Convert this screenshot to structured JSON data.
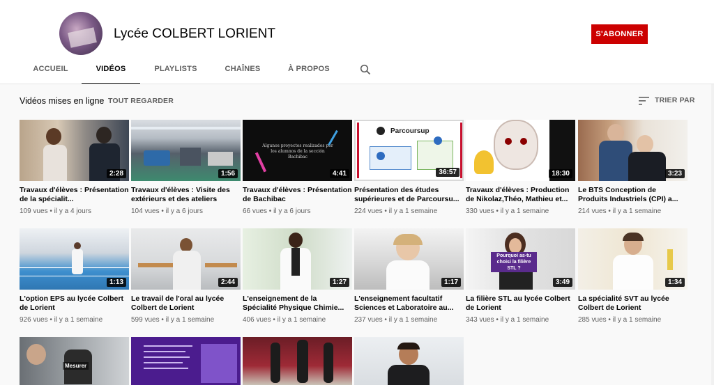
{
  "channel": {
    "title": "Lycée COLBERT LORIENT",
    "subscribe_label": "S'ABONNER"
  },
  "tabs": [
    {
      "label": "ACCUEIL",
      "active": false
    },
    {
      "label": "VIDÉOS",
      "active": true
    },
    {
      "label": "PLAYLISTS",
      "active": false
    },
    {
      "label": "CHAÎNES",
      "active": false
    },
    {
      "label": "À PROPOS",
      "active": false
    }
  ],
  "section": {
    "title": "Vidéos mises en ligne",
    "see_all": "TOUT REGARDER",
    "sort_label": "TRIER PAR"
  },
  "videos": [
    {
      "title": "Travaux d'élèves : Présentation de la spécialit...",
      "duration": "2:28",
      "views": "109 vues",
      "age": "il y a 4 jours"
    },
    {
      "title": "Travaux d'élèves : Visite des extérieurs et des ateliers",
      "duration": "1:56",
      "views": "104 vues",
      "age": "il y a 6 jours"
    },
    {
      "title": "Travaux d'élèves : Présentation de Bachibac",
      "duration": "4:41",
      "views": "66 vues",
      "age": "il y a 6 jours"
    },
    {
      "title": "Présentation des études supérieures et de Parcoursu...",
      "duration": "36:57",
      "views": "224 vues",
      "age": "il y a 1 semaine"
    },
    {
      "title": "Travaux d'élèves : Production de Nikolaz,Théo, Mathieu et...",
      "duration": "18:30",
      "views": "330 vues",
      "age": "il y a 1 semaine"
    },
    {
      "title": "Le BTS Conception de Produits Industriels (CPI) a...",
      "duration": "3:23",
      "views": "214 vues",
      "age": "il y a 1 semaine"
    },
    {
      "title": "L'option EPS au lycée Colbert de Lorient",
      "duration": "1:13",
      "views": "926 vues",
      "age": "il y a 1 semaine"
    },
    {
      "title": "Le travail de l'oral au lycée Colbert de Lorient",
      "duration": "2:44",
      "views": "599 vues",
      "age": "il y a 1 semaine"
    },
    {
      "title": "L'enseignement de la Spécialité Physique Chimie...",
      "duration": "1:27",
      "views": "406 vues",
      "age": "il y a 1 semaine"
    },
    {
      "title": "L'enseignement facultatif Sciences et Laboratoire au...",
      "duration": "1:17",
      "views": "237 vues",
      "age": "il y a 1 semaine"
    },
    {
      "title": "La filière STL au lycée Colbert de Lorient",
      "duration": "3:49",
      "views": "343 vues",
      "age": "il y a 1 semaine"
    },
    {
      "title": "La spécialité SVT au lycée Colbert de Lorient",
      "duration": "1:34",
      "views": "285 vues",
      "age": "il y a 1 semaine"
    }
  ],
  "thumb_text": {
    "bachibac": "Algunos proyectos realizados por los alumnos de la sección Bachibac",
    "parcoursup": "Parcoursup",
    "stl_caption": "Pourquoi as-tu choisi la filière STL ?",
    "mesurer": "Mesurer"
  },
  "icons": {
    "search": "search-icon",
    "sort": "sort-icon"
  },
  "colors": {
    "subscribe": "#cc0000",
    "text_primary": "#030303",
    "text_secondary": "#606060",
    "background": "#f9f9f9"
  }
}
